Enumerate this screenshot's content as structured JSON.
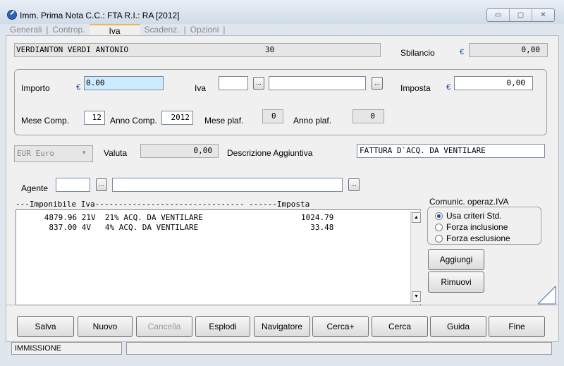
{
  "window": {
    "title": "Imm. Prima Nota C.C.: FTA  R.I.: RA  [2012]",
    "controls": [
      "▭",
      "▢",
      "✕"
    ]
  },
  "tabs": [
    {
      "label": "Generali"
    },
    {
      "label": "Controp."
    },
    {
      "label": "Iva"
    },
    {
      "label": "Scadenz."
    },
    {
      "label": "Opzioni"
    }
  ],
  "header": {
    "name": "VERDIANTON VERDI ANTONIO",
    "code": "30",
    "sbilancio_label": "Sbilancio",
    "sbilancio_value": "0,00",
    "currency_symbol": "€"
  },
  "iva_group": {
    "importo_label": "Importo",
    "importo_value": "0.00",
    "iva_label": "Iva",
    "iva_code": "",
    "iva_desc": "",
    "imposta_label": "Imposta",
    "imposta_value": "0,00",
    "mese_comp_label": "Mese Comp.",
    "mese_comp_value": "12",
    "anno_comp_label": "Anno Comp.",
    "anno_comp_value": "2012",
    "mese_plaf_label": "Mese plaf.",
    "mese_plaf_value": "0",
    "anno_plaf_label": "Anno plaf.",
    "anno_plaf_value": "0",
    "ellipsis": "..."
  },
  "valuta": {
    "currency_select": "EUR Euro",
    "label": "Valuta",
    "value": "0,00",
    "desc_label": "Descrizione Aggiuntiva",
    "desc_value": "FATTURA D`ACQ. DA VENTILARE"
  },
  "agente": {
    "label": "Agente",
    "code": "",
    "name": ""
  },
  "list": {
    "header": "---Imponibile Iva-------------------------------- ------Imposta",
    "rows": [
      "      4879.96 21V  21% ACQ. DA VENTILARE                     1024.79",
      "       837.00 4V   4% ACQ. DA VENTILARE                        33.48"
    ]
  },
  "comunic": {
    "title": "Comunic. operaz.IVA",
    "options": [
      "Usa criteri Std.",
      "Forza inclusione",
      "Forza esclusione"
    ],
    "selected_index": 0
  },
  "side_buttons": {
    "aggiungi": "Aggiungi",
    "rimuovi": "Rimuovi"
  },
  "bottom_buttons": [
    "Salva",
    "Nuovo",
    "Cancella",
    "Esplodi",
    "Navigatore",
    "Cerca+",
    "Cerca",
    "Guida",
    "Fine"
  ],
  "status": {
    "mode": "IMMISSIONE",
    "message": ""
  }
}
